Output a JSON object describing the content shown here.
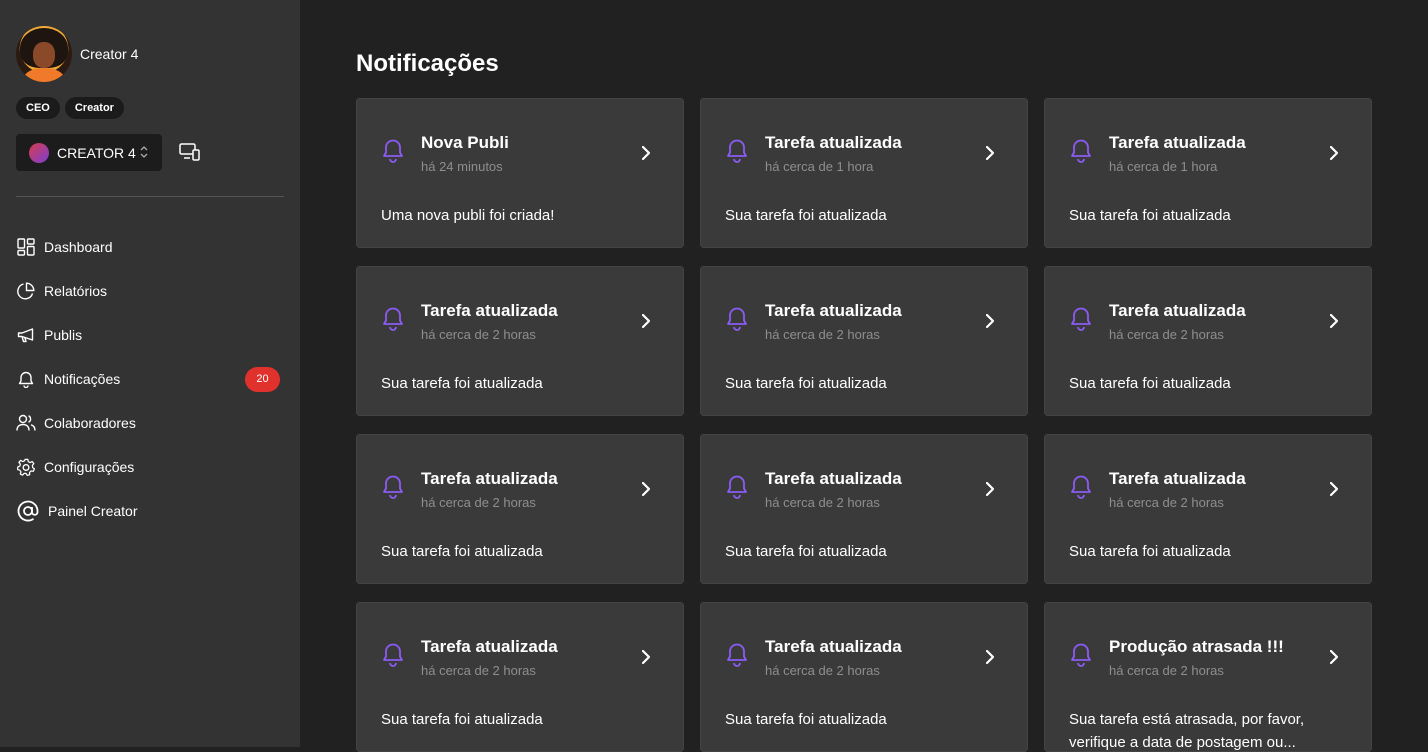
{
  "profile": {
    "name": "Creator 4",
    "roles": [
      "CEO",
      "Creator"
    ]
  },
  "account": {
    "selected": "CREATOR 4"
  },
  "nav": [
    {
      "label": "Dashboard",
      "icon": "dashboard-icon"
    },
    {
      "label": "Relatórios",
      "icon": "pie-chart-icon"
    },
    {
      "label": "Publis",
      "icon": "megaphone-icon"
    },
    {
      "label": "Notificações",
      "icon": "bell-icon",
      "badge": "20"
    },
    {
      "label": "Colaboradores",
      "icon": "users-icon"
    },
    {
      "label": "Configurações",
      "icon": "gear-icon"
    },
    {
      "label": "Painel Creator",
      "icon": "at-sign-icon"
    }
  ],
  "page": {
    "title": "Notificações"
  },
  "colors": {
    "accent": "#8b5cf6",
    "badge": "#e0312c",
    "sidebar": "#333333",
    "background": "#212121",
    "card": "#3a3a3a"
  },
  "notifications": [
    {
      "title": "Nova Publi",
      "time": "há 24 minutos",
      "message": "Uma nova publi foi criada!"
    },
    {
      "title": "Tarefa atualizada",
      "time": "há cerca de 1 hora",
      "message": "Sua tarefa foi atualizada"
    },
    {
      "title": "Tarefa atualizada",
      "time": "há cerca de 1 hora",
      "message": "Sua tarefa foi atualizada"
    },
    {
      "title": "Tarefa atualizada",
      "time": "há cerca de 2 horas",
      "message": "Sua tarefa foi atualizada"
    },
    {
      "title": "Tarefa atualizada",
      "time": "há cerca de 2 horas",
      "message": "Sua tarefa foi atualizada"
    },
    {
      "title": "Tarefa atualizada",
      "time": "há cerca de 2 horas",
      "message": "Sua tarefa foi atualizada"
    },
    {
      "title": "Tarefa atualizada",
      "time": "há cerca de 2 horas",
      "message": "Sua tarefa foi atualizada"
    },
    {
      "title": "Tarefa atualizada",
      "time": "há cerca de 2 horas",
      "message": "Sua tarefa foi atualizada"
    },
    {
      "title": "Tarefa atualizada",
      "time": "há cerca de 2 horas",
      "message": "Sua tarefa foi atualizada"
    },
    {
      "title": "Tarefa atualizada",
      "time": "há cerca de 2 horas",
      "message": "Sua tarefa foi atualizada"
    },
    {
      "title": "Tarefa atualizada",
      "time": "há cerca de 2 horas",
      "message": "Sua tarefa foi atualizada"
    },
    {
      "title": "Produção atrasada !!!",
      "time": "há cerca de 2 horas",
      "message": "Sua tarefa está atrasada, por favor, verifique a data de postagem ou..."
    }
  ]
}
